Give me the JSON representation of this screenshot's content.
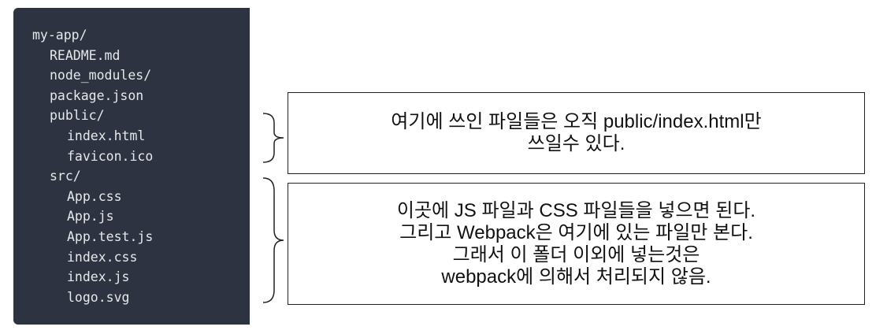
{
  "tree": [
    {
      "name": "my-app/",
      "depth": 0
    },
    {
      "name": "README.md",
      "depth": 1
    },
    {
      "name": "node_modules/",
      "depth": 1
    },
    {
      "name": "package.json",
      "depth": 1
    },
    {
      "name": "public/",
      "depth": 1
    },
    {
      "name": "index.html",
      "depth": 2
    },
    {
      "name": "favicon.ico",
      "depth": 2
    },
    {
      "name": "src/",
      "depth": 1
    },
    {
      "name": "App.css",
      "depth": 2
    },
    {
      "name": "App.js",
      "depth": 2
    },
    {
      "name": "App.test.js",
      "depth": 2
    },
    {
      "name": "index.css",
      "depth": 2
    },
    {
      "name": "index.js",
      "depth": 2
    },
    {
      "name": "logo.svg",
      "depth": 2
    }
  ],
  "notes": {
    "public": [
      "여기에 쓰인 파일들은 오직 public/index.html만",
      "쓰일수 있다."
    ],
    "src": [
      "이곳에 JS 파일과 CSS 파일들을 넣으면 된다.",
      "그리고 Webpack은 여기에 있는 파일만 본다.",
      "그래서 이 폴더 이외에 넣는것은",
      "webpack에 의해서 처리되지 않음."
    ]
  }
}
